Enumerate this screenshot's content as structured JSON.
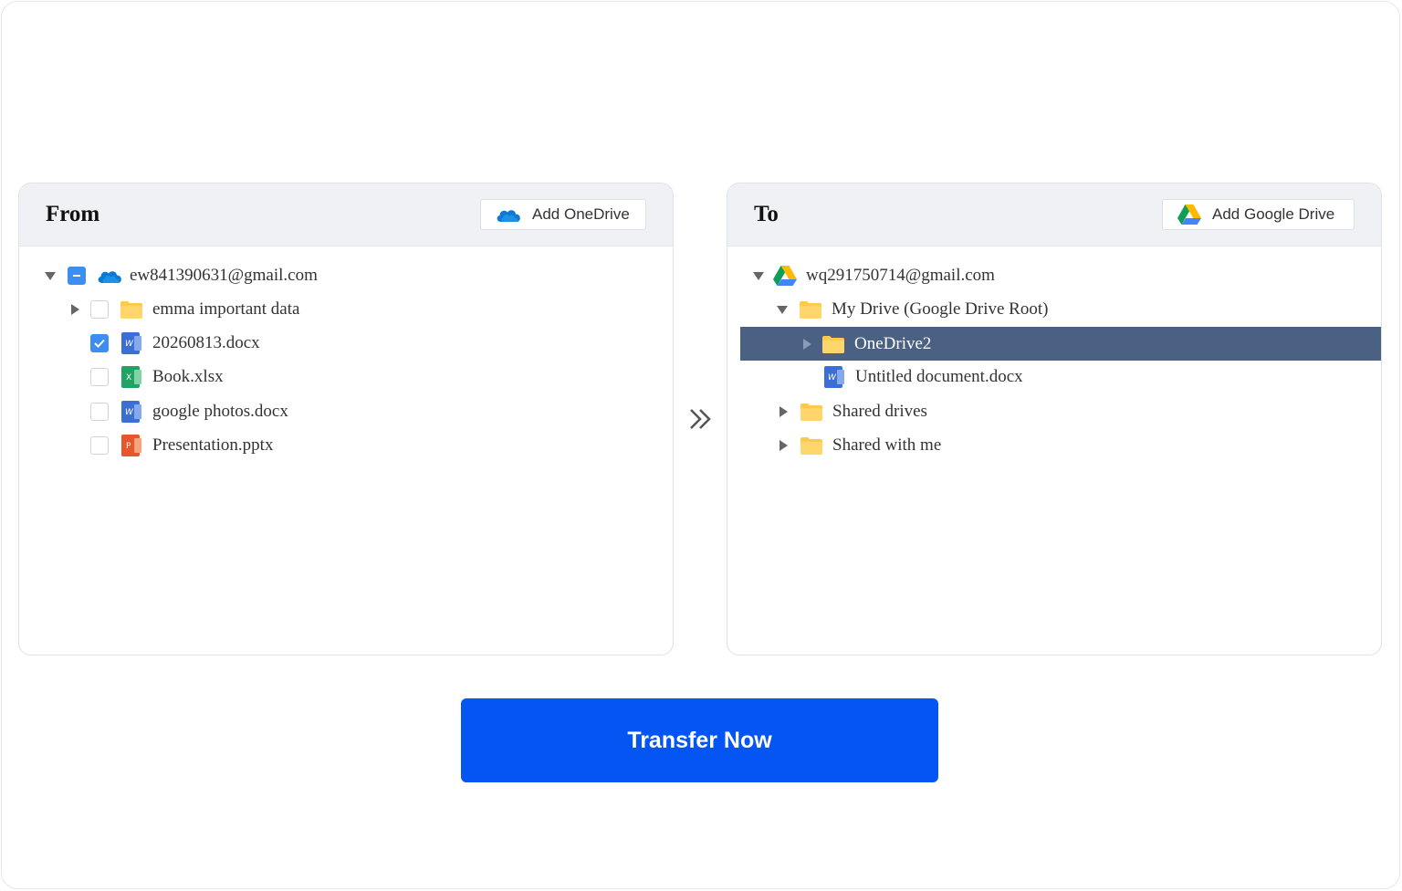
{
  "from_panel": {
    "title": "From",
    "add_button_label": "Add OneDrive",
    "account": "ew841390631@gmail.com",
    "items": [
      {
        "label": "emma important data",
        "type": "folder",
        "checked": false
      },
      {
        "label": "20260813.docx",
        "type": "word",
        "checked": true
      },
      {
        "label": "Book.xlsx",
        "type": "excel",
        "checked": false
      },
      {
        "label": "google photos.docx",
        "type": "word",
        "checked": false
      },
      {
        "label": "Presentation.pptx",
        "type": "powerpoint",
        "checked": false
      }
    ]
  },
  "to_panel": {
    "title": "To",
    "add_button_label": "Add Google Drive",
    "account": "wq291750714@gmail.com",
    "my_drive": "My Drive (Google Drive Root)",
    "selected_folder": "OneDrive2",
    "untitled_doc": "Untitled document.docx",
    "shared_drives": "Shared drives",
    "shared_with_me": "Shared with me"
  },
  "transfer_button_label": "Transfer Now",
  "colors": {
    "primary": "#0555f5",
    "selected_row": "#4b6184",
    "checkbox": "#3d8ef2",
    "folder": "#ffc94a"
  }
}
